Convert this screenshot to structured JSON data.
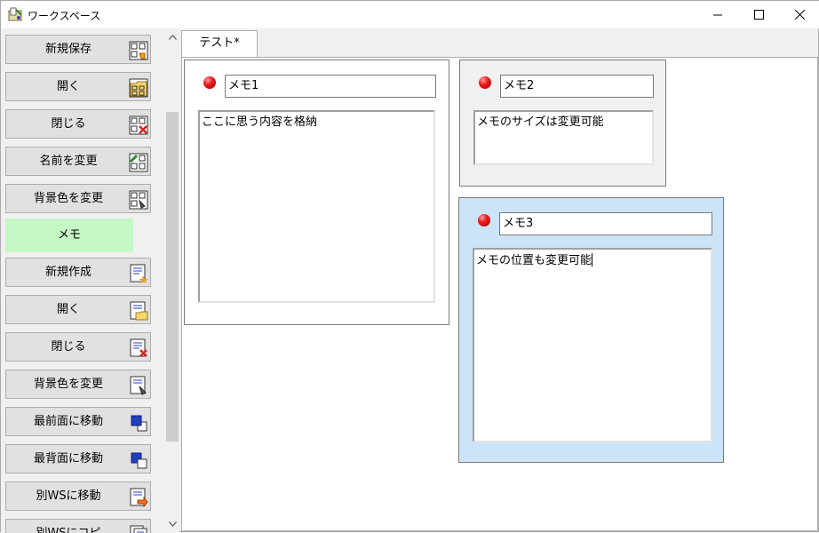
{
  "window": {
    "title": "ワークスペース"
  },
  "sidebar": {
    "workspace_buttons": [
      {
        "label": "新規保存",
        "icon": "grid-save-icon"
      },
      {
        "label": "開く",
        "icon": "grid-open-icon"
      },
      {
        "label": "閉じる",
        "icon": "grid-close-icon"
      },
      {
        "label": "名前を変更",
        "icon": "grid-rename-icon"
      },
      {
        "label": "背景色を変更",
        "icon": "grid-color-icon"
      }
    ],
    "memo_header": "メモ",
    "memo_buttons": [
      {
        "label": "新規作成",
        "icon": "doc-new-icon"
      },
      {
        "label": "開く",
        "icon": "doc-open-icon"
      },
      {
        "label": "閉じる",
        "icon": "doc-close-icon"
      },
      {
        "label": "背景色を変更",
        "icon": "doc-color-icon"
      },
      {
        "label": "最前面に移動",
        "icon": "bring-front-icon"
      },
      {
        "label": "最背面に移動",
        "icon": "send-back-icon"
      },
      {
        "label": "別WSに移動",
        "icon": "doc-move-icon"
      },
      {
        "label": "別WSにコピ",
        "icon": "doc-copy-icon"
      }
    ]
  },
  "tabs": [
    {
      "label": "テスト*"
    }
  ],
  "memos": [
    {
      "title": "メモ1",
      "body": "ここに思う内容を格納",
      "bg": "#ffffff"
    },
    {
      "title": "メモ2",
      "body": "メモのサイズは変更可能",
      "bg": "#f0f0f0"
    },
    {
      "title": "メモ3",
      "body": "メモの位置も変更可能",
      "bg": "#cce4f7"
    }
  ],
  "colors": {
    "memo_header_bg": "#c6f7c6",
    "button_bg": "#e1e1e1",
    "selected_memo_bg": "#cce4f7"
  }
}
